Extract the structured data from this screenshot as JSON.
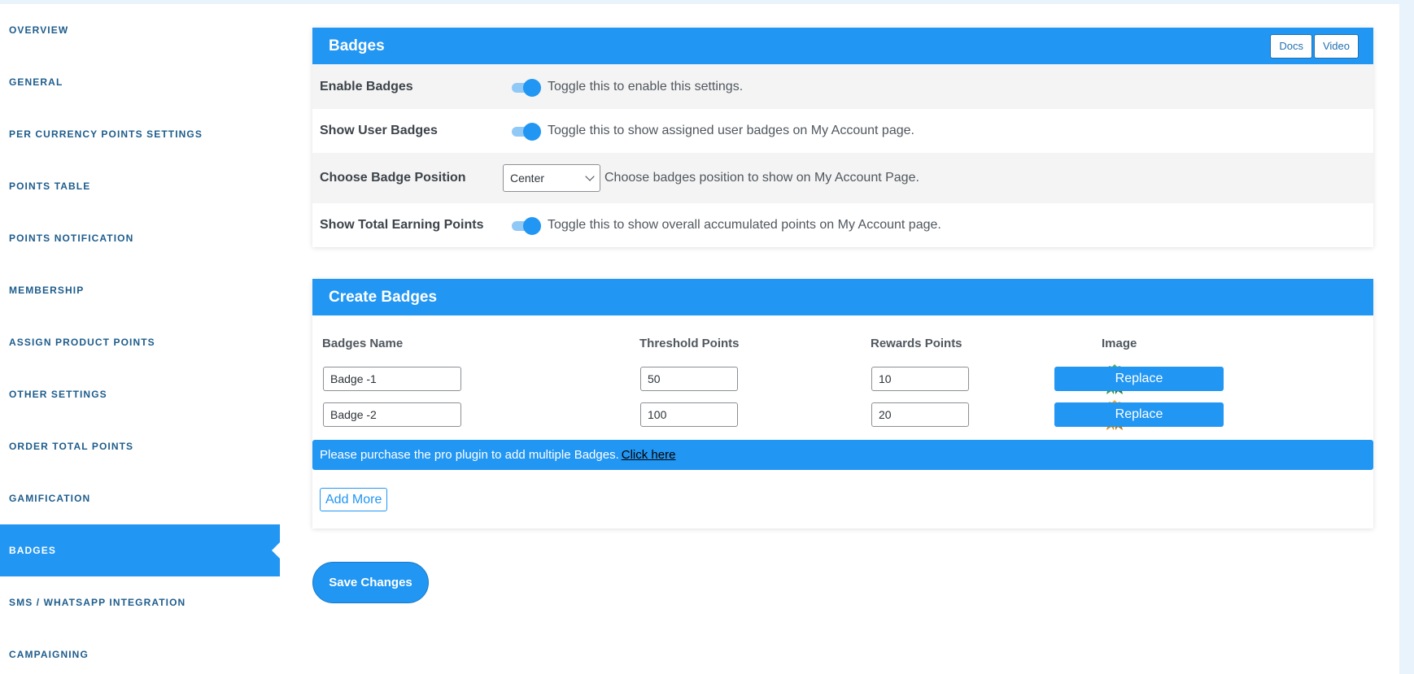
{
  "sidebar": {
    "items": [
      {
        "label": "OVERVIEW"
      },
      {
        "label": "GENERAL"
      },
      {
        "label": "PER CURRENCY POINTS SETTINGS"
      },
      {
        "label": "POINTS TABLE"
      },
      {
        "label": "POINTS NOTIFICATION"
      },
      {
        "label": "MEMBERSHIP"
      },
      {
        "label": "ASSIGN PRODUCT POINTS"
      },
      {
        "label": "OTHER SETTINGS"
      },
      {
        "label": "ORDER TOTAL POINTS"
      },
      {
        "label": "GAMIFICATION"
      },
      {
        "label": "BADGES",
        "active": true
      },
      {
        "label": "SMS / WHATSAPP INTEGRATION"
      },
      {
        "label": "CAMPAIGNING"
      }
    ]
  },
  "badges_card": {
    "title": "Badges",
    "docs_label": "Docs",
    "video_label": "Video",
    "settings": [
      {
        "label": "Enable Badges",
        "type": "toggle",
        "enabled": true,
        "description": "Toggle this to enable this settings."
      },
      {
        "label": "Show User Badges",
        "type": "toggle",
        "enabled": true,
        "description": "Toggle this to show assigned user badges on My Account page."
      },
      {
        "label": "Choose Badge Position",
        "type": "select",
        "value": "Center",
        "description": "Choose badges position to show on My Account Page."
      },
      {
        "label": "Show Total Earning Points",
        "type": "toggle",
        "enabled": true,
        "description": "Toggle this to show overall accumulated points on My Account page."
      }
    ]
  },
  "create_card": {
    "title": "Create Badges",
    "columns": {
      "name": "Badges Name",
      "threshold": "Threshold Points",
      "rewards": "Rewards Points",
      "image": "Image"
    },
    "rows": [
      {
        "name": "Badge -1",
        "threshold": "50",
        "rewards": "10",
        "medal": "green-medal-icon",
        "medal_color": "#4caf50",
        "replace_label": "Replace"
      },
      {
        "name": "Badge -2",
        "threshold": "100",
        "rewards": "20",
        "medal": "orange-medal-icon",
        "medal_color": "#f5a623",
        "replace_label": "Replace"
      }
    ],
    "pro_notice": "Please purchase the pro plugin to add multiple Badges.",
    "pro_link": "Click here",
    "add_more_label": "Add More"
  },
  "save_label": "Save Changes",
  "colors": {
    "accent": "#2196f3",
    "nav_text": "#1d5c8c",
    "page_bg": "#e9f3fb"
  }
}
